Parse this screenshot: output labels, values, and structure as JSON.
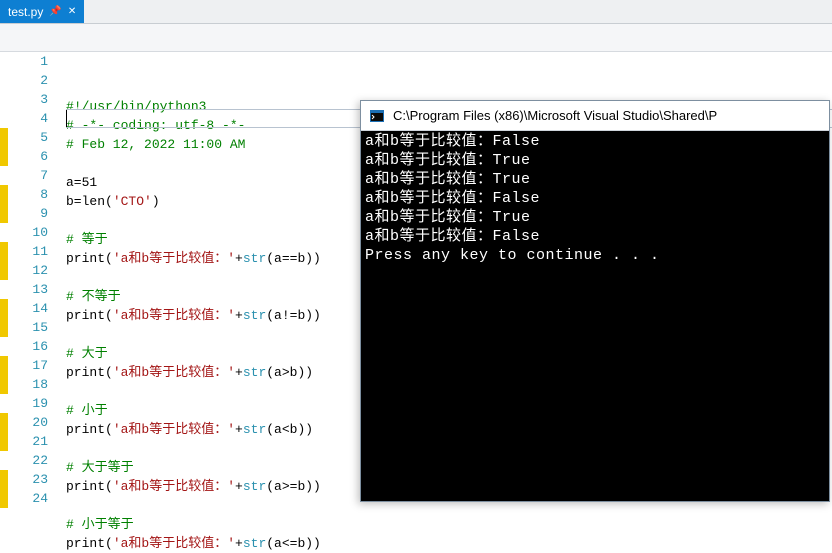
{
  "tab": {
    "filename": "test.py",
    "pinned": true
  },
  "editor": {
    "active_line": 4,
    "lines": [
      {
        "n": 1,
        "mod": false,
        "segs": [
          {
            "t": "#!/usr/bin/python3",
            "cls": "c-comment"
          }
        ]
      },
      {
        "n": 2,
        "mod": false,
        "segs": [
          {
            "t": "# -*- coding: utf-8 -*-",
            "cls": "c-comment"
          }
        ]
      },
      {
        "n": 3,
        "mod": false,
        "segs": [
          {
            "t": "# Feb 12, 2022 11:00 AM",
            "cls": "c-comment"
          }
        ]
      },
      {
        "n": 4,
        "mod": false,
        "segs": []
      },
      {
        "n": 5,
        "mod": true,
        "segs": [
          {
            "t": "a=51",
            "cls": ""
          }
        ]
      },
      {
        "n": 6,
        "mod": true,
        "segs": [
          {
            "t": "b=len(",
            "cls": ""
          },
          {
            "t": "'CTO'",
            "cls": "c-str"
          },
          {
            "t": ")",
            "cls": ""
          }
        ]
      },
      {
        "n": 7,
        "mod": false,
        "segs": []
      },
      {
        "n": 8,
        "mod": true,
        "segs": [
          {
            "t": "# 等于",
            "cls": "c-comment"
          }
        ]
      },
      {
        "n": 9,
        "mod": true,
        "segs": [
          {
            "t": "print(",
            "cls": ""
          },
          {
            "t": "'a和b等于比较值：'",
            "cls": "c-str"
          },
          {
            "t": "+",
            "cls": ""
          },
          {
            "t": "str",
            "cls": "c-kw"
          },
          {
            "t": "(a==b))",
            "cls": ""
          }
        ]
      },
      {
        "n": 10,
        "mod": false,
        "segs": []
      },
      {
        "n": 11,
        "mod": true,
        "segs": [
          {
            "t": "# 不等于",
            "cls": "c-comment"
          }
        ]
      },
      {
        "n": 12,
        "mod": true,
        "segs": [
          {
            "t": "print(",
            "cls": ""
          },
          {
            "t": "'a和b等于比较值：'",
            "cls": "c-str"
          },
          {
            "t": "+",
            "cls": ""
          },
          {
            "t": "str",
            "cls": "c-kw"
          },
          {
            "t": "(a!=b))",
            "cls": ""
          }
        ]
      },
      {
        "n": 13,
        "mod": false,
        "segs": []
      },
      {
        "n": 14,
        "mod": true,
        "segs": [
          {
            "t": "# 大于",
            "cls": "c-comment"
          }
        ]
      },
      {
        "n": 15,
        "mod": true,
        "segs": [
          {
            "t": "print(",
            "cls": ""
          },
          {
            "t": "'a和b等于比较值：'",
            "cls": "c-str"
          },
          {
            "t": "+",
            "cls": ""
          },
          {
            "t": "str",
            "cls": "c-kw"
          },
          {
            "t": "(a>b))",
            "cls": ""
          }
        ]
      },
      {
        "n": 16,
        "mod": false,
        "segs": []
      },
      {
        "n": 17,
        "mod": true,
        "segs": [
          {
            "t": "# 小于",
            "cls": "c-comment"
          }
        ]
      },
      {
        "n": 18,
        "mod": true,
        "segs": [
          {
            "t": "print(",
            "cls": ""
          },
          {
            "t": "'a和b等于比较值：'",
            "cls": "c-str"
          },
          {
            "t": "+",
            "cls": ""
          },
          {
            "t": "str",
            "cls": "c-kw"
          },
          {
            "t": "(a<b))",
            "cls": ""
          }
        ]
      },
      {
        "n": 19,
        "mod": false,
        "segs": []
      },
      {
        "n": 20,
        "mod": true,
        "segs": [
          {
            "t": "# 大于等于",
            "cls": "c-comment"
          }
        ]
      },
      {
        "n": 21,
        "mod": true,
        "segs": [
          {
            "t": "print(",
            "cls": ""
          },
          {
            "t": "'a和b等于比较值：'",
            "cls": "c-str"
          },
          {
            "t": "+",
            "cls": ""
          },
          {
            "t": "str",
            "cls": "c-kw"
          },
          {
            "t": "(a>=b))",
            "cls": ""
          }
        ]
      },
      {
        "n": 22,
        "mod": false,
        "segs": []
      },
      {
        "n": 23,
        "mod": true,
        "segs": [
          {
            "t": "# 小于等于",
            "cls": "c-comment"
          }
        ]
      },
      {
        "n": 24,
        "mod": true,
        "segs": [
          {
            "t": "print(",
            "cls": ""
          },
          {
            "t": "'a和b等于比较值：'",
            "cls": "c-str"
          },
          {
            "t": "+",
            "cls": ""
          },
          {
            "t": "str",
            "cls": "c-kw"
          },
          {
            "t": "(a<=b))",
            "cls": ""
          }
        ]
      }
    ]
  },
  "console": {
    "title": "C:\\Program Files (x86)\\Microsoft Visual Studio\\Shared\\P",
    "output_lines": [
      "a和b等于比较值：False",
      "a和b等于比较值：True",
      "a和b等于比较值：True",
      "a和b等于比较值：False",
      "a和b等于比较值：True",
      "a和b等于比较值：False",
      "Press any key to continue . . ."
    ]
  }
}
